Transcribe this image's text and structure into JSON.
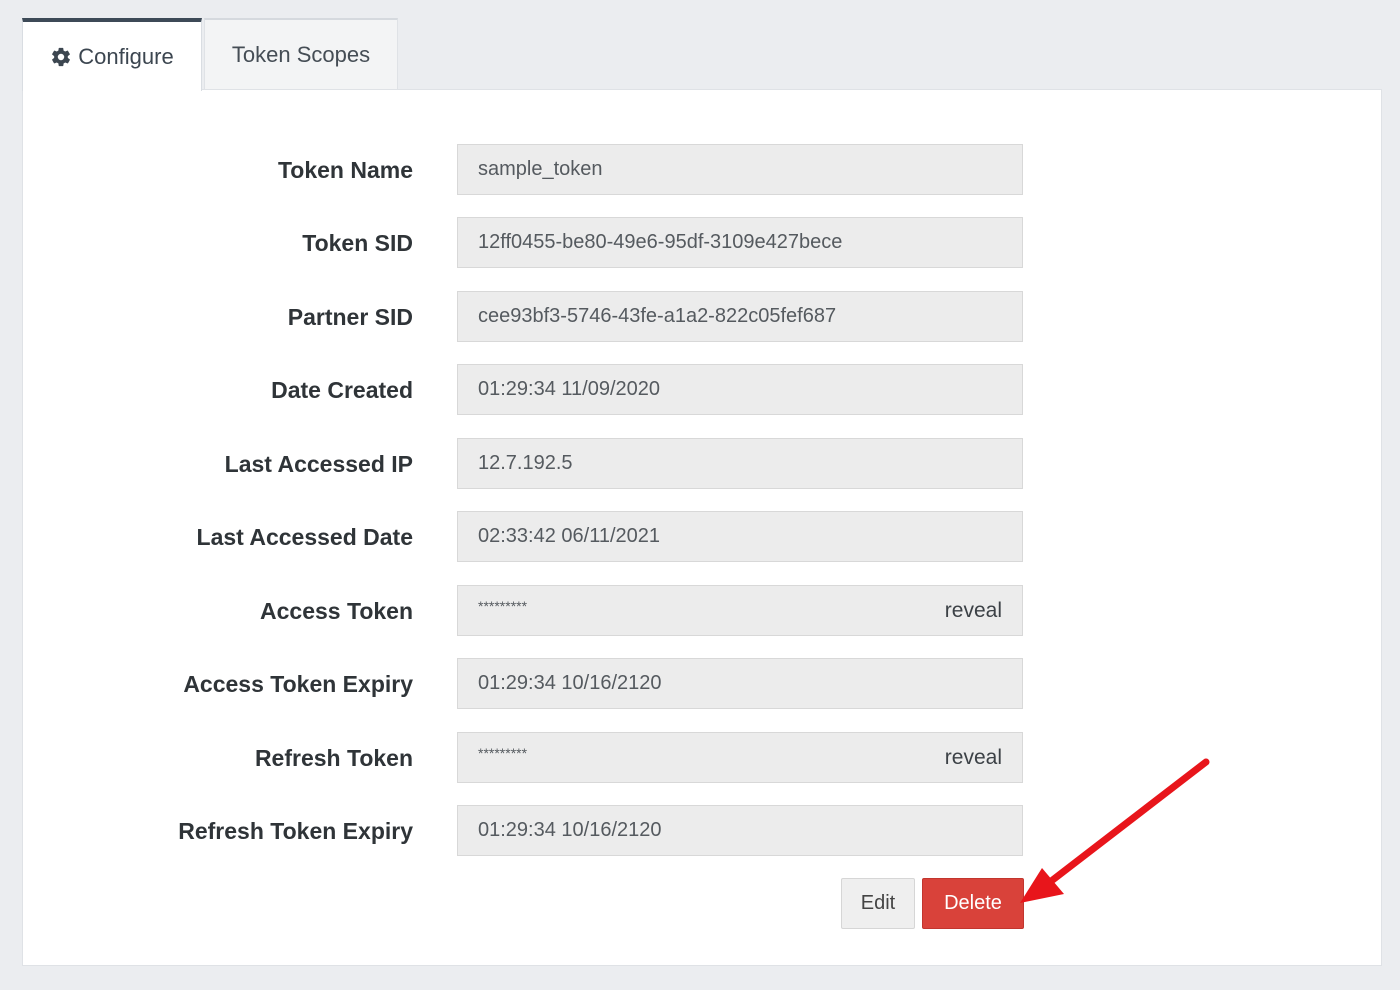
{
  "tabs": [
    {
      "label": "Configure",
      "icon": "gear-icon",
      "active": true
    },
    {
      "label": "Token Scopes",
      "active": false
    }
  ],
  "fields": {
    "token_name": {
      "label": "Token Name",
      "value": "sample_token"
    },
    "token_sid": {
      "label": "Token SID",
      "value": "12ff0455-be80-49e6-95df-3109e427bece"
    },
    "partner_sid": {
      "label": "Partner SID",
      "value": "cee93bf3-5746-43fe-a1a2-822c05fef687"
    },
    "date_created": {
      "label": "Date Created",
      "value": "01:29:34 11/09/2020"
    },
    "last_accessed_ip": {
      "label": "Last Accessed IP",
      "value": "12.7.192.5"
    },
    "last_accessed_date": {
      "label": "Last Accessed Date",
      "value": "02:33:42 06/11/2021"
    },
    "access_token": {
      "label": "Access Token",
      "value": "*********",
      "action": "reveal"
    },
    "access_token_expiry": {
      "label": "Access Token Expiry",
      "value": "01:29:34 10/16/2120"
    },
    "refresh_token": {
      "label": "Refresh Token",
      "value": "*********",
      "action": "reveal"
    },
    "refresh_token_expiry": {
      "label": "Refresh Token Expiry",
      "value": "01:29:34 10/16/2120"
    }
  },
  "buttons": {
    "edit": "Edit",
    "delete": "Delete"
  },
  "colors": {
    "delete": "#d9423a",
    "annotation_arrow": "#e8151b",
    "active_tab_border": "#3d4a57"
  }
}
